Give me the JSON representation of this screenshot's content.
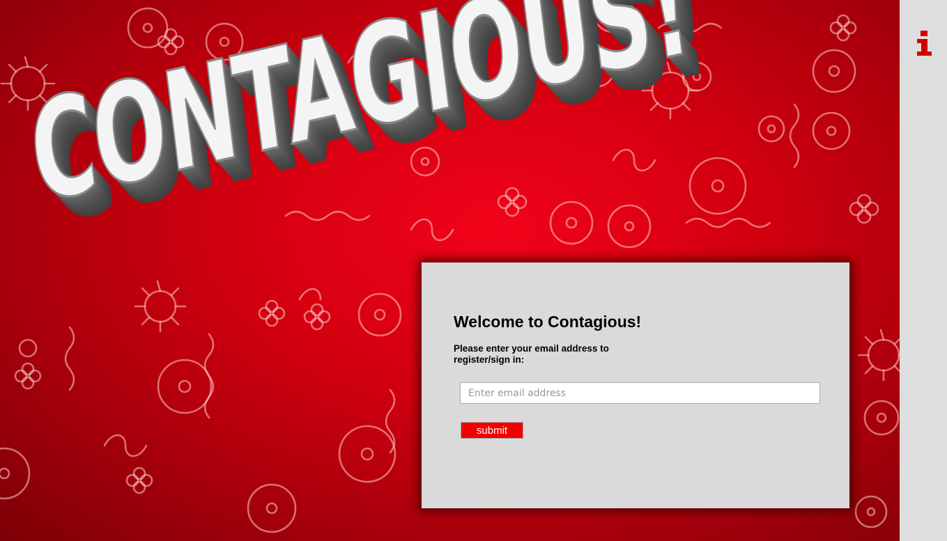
{
  "logo": {
    "text": "CONTAGIOUS!",
    "colors": {
      "face": "#f4f4f4",
      "extrude": "#4c4c4c"
    }
  },
  "sidebar": {
    "info_icon": "info-icon"
  },
  "welcome": {
    "title": "Welcome to Contagious!",
    "prompt": "Please enter your email address to register/sign in:",
    "email_placeholder": "Enter email address",
    "email_value": "",
    "submit_label": "submit"
  },
  "colors": {
    "background": "#d1000f",
    "card": "#dadada",
    "submit": "#f20000",
    "sidebar": "#dedede",
    "accent_icon": "#d40000"
  }
}
